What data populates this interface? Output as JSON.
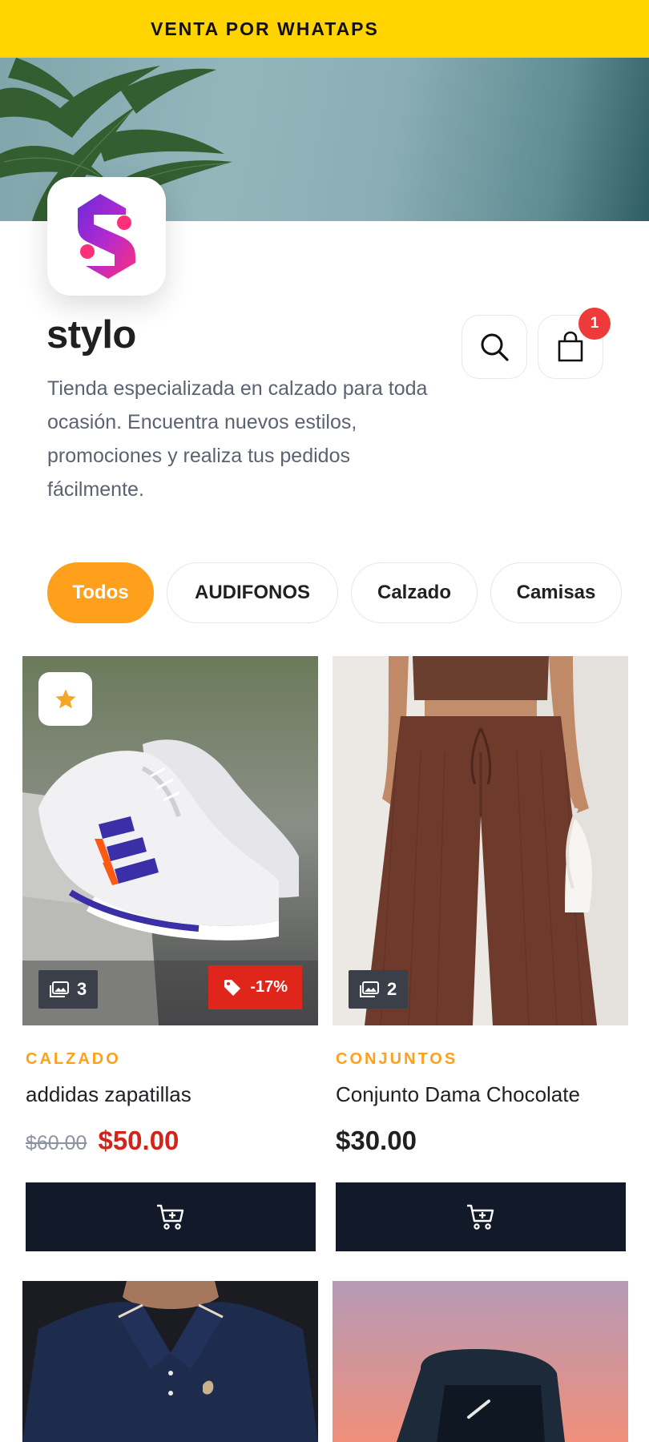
{
  "announcement": "VENTA POR WHATAPS",
  "store": {
    "name": "stylo",
    "description": "Tienda especializada en calzado para toda ocasión. Encuentra nuevos estilos, promociones y realiza tus pedidos fácilmente."
  },
  "header_actions": {
    "search_icon": "search-icon",
    "cart_icon": "shopping-bag-icon",
    "cart_count": "1"
  },
  "categories": [
    "Todos",
    "AUDIFONOS",
    "Calzado",
    "Camisas"
  ],
  "active_category": "Todos",
  "products": [
    {
      "category": "CALZADO",
      "name": "addidas zapatillas",
      "old_price": "$60.00",
      "price": "$50.00",
      "image_count": "3",
      "discount": "-17%",
      "featured": true
    },
    {
      "category": "CONJUNTOS",
      "name": "Conjunto Dama Chocolate",
      "price": "$30.00",
      "image_count": "2"
    }
  ],
  "colors": {
    "announcement_bg": "#ffd400",
    "accent": "#ffa01c",
    "sale_red": "#e0251b",
    "button_dark": "#121a2a",
    "badge_red": "#ef3a3a"
  }
}
